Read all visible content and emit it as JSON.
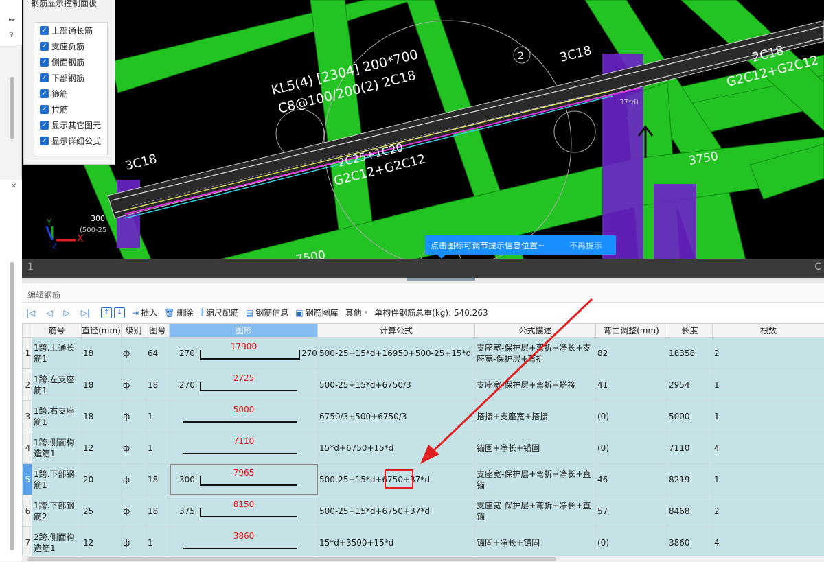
{
  "left_strip": {
    "top_glyph": "▸▸",
    "search_glyph": "⚲",
    "close_glyph": "✕"
  },
  "viewport": {
    "labels": {
      "beam_line1": "KL5(4) [2304] 200*700",
      "beam_line2": "C8@100/200(2) 2C18",
      "top_left_3c18": "3C18",
      "top_mid_3c18": "3C18",
      "right_2c18": "2C18",
      "right_g2c12": "G2C12+G2C12",
      "mid_2c25": "2C25+1C20",
      "mid_g2c12": "G2C12+G2C12",
      "dim_3750": "3750",
      "dim_7500": "7500",
      "dim_300": "300",
      "small_500": "(500-25",
      "tag_37d": "37*d)",
      "circle_2": "2",
      "axis_x": "X",
      "axis_y": "Y",
      "axis_z": "Z"
    },
    "status_left": "1",
    "status_right": "C"
  },
  "panel": {
    "title": "钢筋显示控制面板",
    "items": [
      "上部通长筋",
      "支座负筋",
      "侧面钢筋",
      "下部钢筋",
      "箍筋",
      "拉筋",
      "显示其它图元",
      "显示详细公式"
    ],
    "check_glyph": "✓"
  },
  "tip": {
    "text": "点击图标可调节提示信息位置~",
    "dismiss": "不再提示"
  },
  "editor": {
    "title": "编辑钢筋",
    "toolbar": {
      "insert": "插入",
      "delete": "删除",
      "scale": "缩尺配筋",
      "rebar_info": "钢筋信息",
      "rebar_lib": "钢筋图库",
      "other": "其他",
      "weight_label": "单构件钢筋总重(kg): 540.263"
    },
    "columns": [
      "筋号",
      "直径(mm)",
      "级别",
      "图号",
      "图形",
      "计算公式",
      "公式描述",
      "弯曲调整(mm)",
      "长度",
      "根数"
    ],
    "rows": [
      {
        "n": "1",
        "name": "1跨.上通长筋1",
        "dia": "18",
        "grade": "ф",
        "fig": "64",
        "left": "270",
        "mid": "17900",
        "right": "270",
        "formula": "500-25+15*d+16950+500-25+15*d",
        "desc": "支座宽-保护层+弯折+净长+支座宽-保护层+弯折",
        "bend": "82",
        "len": "18358",
        "count": "2"
      },
      {
        "n": "2",
        "name": "1跨.左支座筋1",
        "dia": "18",
        "grade": "ф",
        "fig": "18",
        "left": "270",
        "mid": "2725",
        "right": "",
        "formula": "500-25+15*d+6750/3",
        "desc": "支座宽-保护层+弯折+搭接",
        "bend": "41",
        "len": "2954",
        "count": "1"
      },
      {
        "n": "3",
        "name": "1跨.右支座筋1",
        "dia": "18",
        "grade": "ф",
        "fig": "1",
        "left": "",
        "mid": "5000",
        "right": "",
        "formula": "6750/3+500+6750/3",
        "desc": "搭接+支座宽+搭接",
        "bend": "(0)",
        "len": "5000",
        "count": "1"
      },
      {
        "n": "4",
        "name": "1跨.侧面构造筋1",
        "dia": "12",
        "grade": "ф",
        "fig": "1",
        "left": "",
        "mid": "7110",
        "right": "",
        "formula": "15*d+6750+15*d",
        "desc": "锚固+净长+锚固",
        "bend": "(0)",
        "len": "7110",
        "count": "4"
      },
      {
        "n": "5",
        "name": "1跨.下部钢筋1",
        "dia": "20",
        "grade": "ф",
        "fig": "18",
        "left": "300",
        "mid": "7965",
        "right": "",
        "formula": "500-25+15*d+6750+37*d",
        "desc": "支座宽-保护层+弯折+净长+直锚",
        "bend": "46",
        "len": "8219",
        "count": "1"
      },
      {
        "n": "6",
        "name": "1跨.下部钢筋2",
        "dia": "25",
        "grade": "ф",
        "fig": "18",
        "left": "375",
        "mid": "8150",
        "right": "",
        "formula": "500-25+15*d+6750+37*d",
        "desc": "支座宽-保护层+弯折+净长+直锚",
        "bend": "57",
        "len": "8468",
        "count": "2"
      },
      {
        "n": "7",
        "name": "2跨.侧面构造筋1",
        "dia": "12",
        "grade": "ф",
        "fig": "1",
        "left": "",
        "mid": "3860",
        "right": "",
        "formula": "15*d+3500+15*d",
        "desc": "锚固+净长+锚固",
        "bend": "(0)",
        "len": "3860",
        "count": "4"
      }
    ]
  },
  "colors": {
    "beam_green": "#22c322",
    "column_purple": "#7a28d8",
    "accent_blue": "#1890ff",
    "row_bg": "#c5e3e6",
    "annotation_red": "#e02020"
  }
}
